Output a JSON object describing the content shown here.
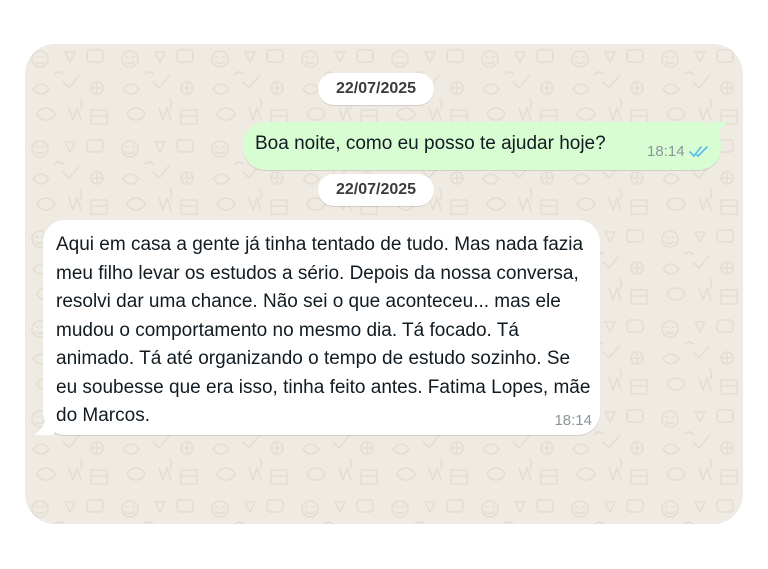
{
  "conversation": {
    "date_1": "22/07/2025",
    "date_2": "22/07/2025",
    "outgoing": {
      "text": "Boa noite, como eu posso te ajudar hoje?",
      "time": "18:14",
      "status_icon": "double-check-read-icon"
    },
    "incoming": {
      "text": "Aqui em casa a gente já tinha tentado de tudo. Mas nada fazia meu filho levar os estudos a sério. Depois da nossa conversa, resolvi dar uma chance. Não sei o que aconteceu... mas ele mudou o comportamento no mesmo dia. Tá focado. Tá animado. Tá até organizando o tempo de estudo sozinho. Se eu soubesse que era isso, tinha feito antes. Fatima Lopes, mãe do Marcos.",
      "time": "18:14"
    }
  },
  "colors": {
    "wallpaper": "#efeae2",
    "outgoing_bubble": "#d9fdd3",
    "incoming_bubble": "#ffffff",
    "read_ticks": "#53bdeb"
  }
}
